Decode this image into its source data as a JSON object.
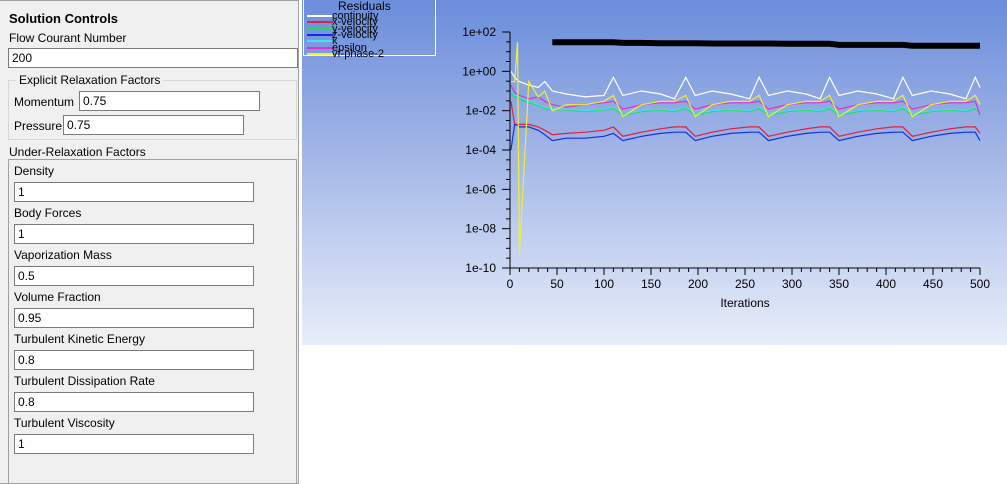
{
  "panel": {
    "title": "Solution Controls",
    "courant_label": "Flow Courant Number",
    "courant_value": "200",
    "explicit_title": "Explicit Relaxation Factors",
    "momentum_label": "Momentum",
    "momentum_value": "0.75",
    "pressure_label": "Pressure",
    "pressure_value": "0.75",
    "under_title": "Under-Relaxation Factors",
    "under_items": [
      {
        "label": "Density",
        "value": "1"
      },
      {
        "label": "Body Forces",
        "value": "1"
      },
      {
        "label": "Vaporization Mass",
        "value": "0.5"
      },
      {
        "label": "Volume Fraction",
        "value": "0.95"
      },
      {
        "label": "Turbulent Kinetic Energy",
        "value": "0.8"
      },
      {
        "label": "Turbulent Dissipation Rate",
        "value": "0.8"
      },
      {
        "label": "Turbulent Viscosity",
        "value": "1"
      }
    ]
  },
  "chart_data": {
    "type": "line",
    "title": "Residuals",
    "xlabel": "Iterations",
    "ylabel": "",
    "xlim": [
      0,
      500
    ],
    "ylim": [
      1e-10,
      100
    ],
    "yscale": "log",
    "xticks": [
      "0",
      "50",
      "100",
      "150",
      "200",
      "250",
      "300",
      "350",
      "400",
      "450",
      "500"
    ],
    "yticks": [
      "1e+02",
      "1e+00",
      "1e-02",
      "1e-04",
      "1e-06",
      "1e-08",
      "1e-10"
    ],
    "legend_position": "top-left",
    "x": [
      1,
      5,
      8,
      10,
      20,
      30,
      37,
      45,
      60,
      80,
      100,
      110,
      120,
      140,
      160,
      175,
      187,
      197,
      215,
      235,
      255,
      265,
      275,
      295,
      315,
      330,
      340,
      350,
      370,
      390,
      408,
      418,
      428,
      448,
      468,
      485,
      495,
      500
    ],
    "series": [
      {
        "name": "continuity",
        "color": "#ffffff",
        "values": [
          1,
          0.5,
          0.35,
          0.3,
          0.2,
          0.15,
          0.3,
          0.1,
          0.07,
          0.05,
          0.06,
          0.5,
          0.06,
          0.1,
          0.07,
          0.04,
          0.5,
          0.06,
          0.1,
          0.07,
          0.04,
          0.5,
          0.06,
          0.1,
          0.07,
          0.04,
          0.5,
          0.06,
          0.1,
          0.07,
          0.04,
          0.5,
          0.06,
          0.1,
          0.07,
          0.04,
          0.5,
          0.15
        ]
      },
      {
        "name": "x-velocity",
        "color": "#e0203c",
        "values": [
          0.03,
          0.002,
          0.002,
          0.002,
          0.002,
          0.0015,
          0.001,
          0.0006,
          0.0007,
          0.0008,
          0.001,
          0.0015,
          0.0005,
          0.0008,
          0.0012,
          0.0015,
          0.0015,
          0.0005,
          0.0008,
          0.0012,
          0.0015,
          0.0015,
          0.0005,
          0.0008,
          0.0012,
          0.0015,
          0.0015,
          0.0005,
          0.0008,
          0.0012,
          0.0015,
          0.0015,
          0.0005,
          0.0008,
          0.0012,
          0.0015,
          0.0015,
          0.0007
        ]
      },
      {
        "name": "y-velocity",
        "color": "#22dd55",
        "values": [
          0.08,
          0.05,
          0.045,
          0.04,
          0.025,
          0.018,
          0.013,
          0.011,
          0.011,
          0.009,
          0.011,
          0.013,
          0.006,
          0.009,
          0.011,
          0.009,
          0.013,
          0.006,
          0.009,
          0.011,
          0.009,
          0.013,
          0.006,
          0.009,
          0.011,
          0.009,
          0.013,
          0.006,
          0.009,
          0.011,
          0.009,
          0.013,
          0.006,
          0.009,
          0.011,
          0.009,
          0.013,
          0.007
        ]
      },
      {
        "name": "z-velocity",
        "color": "#1030e0",
        "values": [
          0.0001,
          0.002,
          0.0018,
          0.0015,
          0.0015,
          0.001,
          0.0006,
          0.0003,
          0.0004,
          0.0004,
          0.0005,
          0.0007,
          0.0003,
          0.0005,
          0.0007,
          0.0008,
          0.0008,
          0.0003,
          0.0005,
          0.0007,
          0.0008,
          0.0008,
          0.0003,
          0.0005,
          0.0007,
          0.0008,
          0.0008,
          0.0003,
          0.0005,
          0.0007,
          0.0008,
          0.0008,
          0.0003,
          0.0005,
          0.0007,
          0.0008,
          0.0008,
          0.0003
        ]
      },
      {
        "name": "k",
        "color": "#40e0f0",
        "values": [
          0.1,
          0.06,
          0.055,
          0.05,
          0.03,
          0.02,
          0.015,
          0.012,
          0.012,
          0.01,
          0.012,
          0.015,
          0.007,
          0.01,
          0.012,
          0.01,
          0.015,
          0.007,
          0.01,
          0.012,
          0.01,
          0.015,
          0.007,
          0.01,
          0.012,
          0.01,
          0.015,
          0.007,
          0.01,
          0.012,
          0.01,
          0.015,
          0.007,
          0.01,
          0.012,
          0.01,
          0.015,
          0.008
        ]
      },
      {
        "name": "epsilon",
        "color": "#e030d0",
        "values": [
          0.2,
          0.08,
          0.07,
          0.06,
          0.04,
          0.05,
          0.03,
          0.02,
          0.015,
          0.02,
          0.025,
          0.03,
          0.012,
          0.02,
          0.025,
          0.025,
          0.03,
          0.012,
          0.02,
          0.025,
          0.025,
          0.03,
          0.012,
          0.02,
          0.025,
          0.025,
          0.03,
          0.012,
          0.02,
          0.025,
          0.025,
          0.03,
          0.012,
          0.02,
          0.025,
          0.025,
          0.03,
          0.006
        ]
      },
      {
        "name": "vf-phase-2",
        "color": "#f0f030",
        "values": [
          0.3,
          0.3,
          30,
          5e-10,
          0.3,
          0.05,
          0.1,
          0.01,
          0.02,
          0.02,
          0.03,
          0.06,
          0.005,
          0.02,
          0.03,
          0.03,
          0.06,
          0.005,
          0.02,
          0.03,
          0.03,
          0.06,
          0.005,
          0.02,
          0.03,
          0.03,
          0.06,
          0.005,
          0.02,
          0.03,
          0.03,
          0.06,
          0.005,
          0.02,
          0.03,
          0.03,
          0.06,
          0.02
        ]
      },
      {
        "name": "",
        "color": "#000000",
        "values": [
          null,
          null,
          null,
          null,
          null,
          null,
          null,
          30,
          30,
          30,
          30,
          30,
          28,
          28,
          27,
          27,
          27,
          27,
          26,
          26,
          26,
          26,
          26,
          25,
          25,
          25,
          25,
          22,
          22,
          22,
          22,
          22,
          20,
          20,
          20,
          20,
          20,
          20
        ]
      }
    ]
  }
}
